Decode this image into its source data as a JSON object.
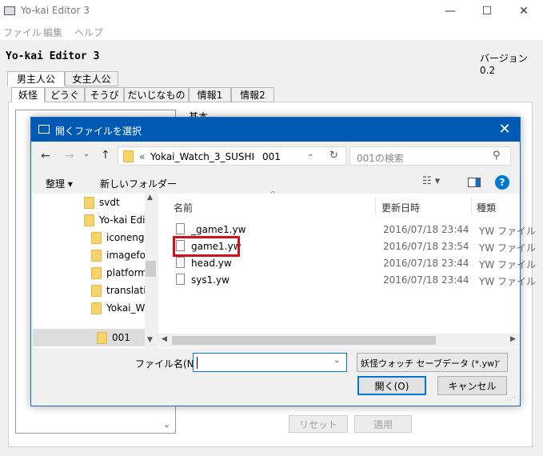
{
  "main": {
    "title": "Yo-kai Editor 3",
    "window_controls": {
      "minimize": "—",
      "maximize": "☐",
      "close": "✕"
    },
    "menu": [
      "ファイル",
      "編集",
      "ヘルプ"
    ],
    "app_name": "Yo-kai Editor 3",
    "version": "バージョン 0.2",
    "main_tabs": [
      "男主人公",
      "女主人公"
    ],
    "sub_tabs": [
      "妖怪",
      "どうぐ",
      "そうび",
      "だいじなもの",
      "情報1",
      "情報2"
    ],
    "section_label": "基本",
    "reset_button": "リセット",
    "apply_button": "適用"
  },
  "dialog": {
    "title": "開くファイルを選択",
    "address": {
      "crumbs": [
        "«",
        "Yokai_Watch_3_SUSHI",
        "›",
        "001"
      ]
    },
    "search_placeholder": "001の検索",
    "organize_label": "整理 ▾",
    "new_folder_label": "新しいフォルダー",
    "nav_items": [
      {
        "label": "svdt"
      },
      {
        "label": "Yo-kai Edit"
      },
      {
        "label": "iconengi"
      },
      {
        "label": "imagefor"
      },
      {
        "label": "platform"
      },
      {
        "label": "translatio"
      },
      {
        "label": "Yokai_Wa"
      },
      {
        "label": "001"
      }
    ],
    "columns": {
      "name": "名前",
      "date": "更新日時",
      "type": "種類"
    },
    "files": [
      {
        "name": "_game1.yw",
        "date": "2016/07/18 23:44",
        "type": "YW ファイル"
      },
      {
        "name": "game1.yw",
        "date": "2016/07/18 23:54",
        "type": "YW ファイル"
      },
      {
        "name": "head.yw",
        "date": "2016/07/18 23:44",
        "type": "YW ファイル"
      },
      {
        "name": "sys1.yw",
        "date": "2016/07/18 23:44",
        "type": "YW ファイル"
      }
    ],
    "filename_label": "ファイル名(N):",
    "filename_value": "",
    "filetype_value": "妖怪ウォッチ セーブデータ (*.yw)",
    "open_button": "開く(O)",
    "cancel_button": "キャンセル"
  },
  "colors": {
    "dialog_title": "#0059b3",
    "highlight": "#d0101a",
    "folder": "#f7d46b",
    "help": "#0078d7"
  }
}
